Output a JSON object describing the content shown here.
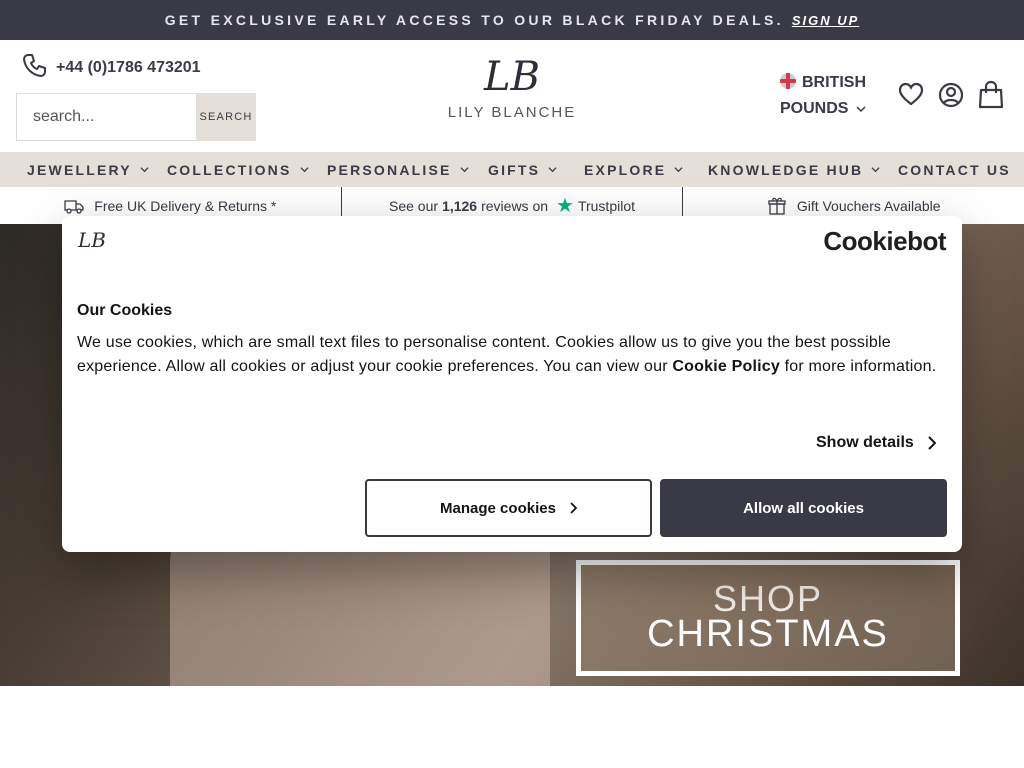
{
  "promo": {
    "text": "GET EXCLUSIVE EARLY ACCESS TO OUR BLACK FRIDAY DEALS.",
    "link": "SIGN UP"
  },
  "header": {
    "phone": "+44 (0)1786 473201",
    "search_placeholder": "search...",
    "search_button": "SEARCH",
    "logo_monogram": "LB",
    "logo_name": "LILY BLANCHE",
    "currency_line1": "BRITISH",
    "currency_line2": "POUNDS",
    "icons": [
      "phone-icon",
      "heart-icon",
      "account-icon",
      "bag-icon",
      "chevron-down-icon"
    ]
  },
  "nav": {
    "items": [
      {
        "label": "JEWELLERY"
      },
      {
        "label": "COLLECTIONS"
      },
      {
        "label": "PERSONALISE"
      },
      {
        "label": "GIFTS"
      },
      {
        "label": "EXPLORE"
      },
      {
        "label": "KNOWLEDGE HUB"
      },
      {
        "label": "CONTACT US"
      }
    ]
  },
  "usp": {
    "delivery": "Free UK Delivery & Returns *",
    "reviews_pre": "See our",
    "reviews_count": "1,126",
    "reviews_post": "reviews on",
    "trustpilot": "Trustpilot",
    "vouchers": "Gift Vouchers Available"
  },
  "hero": {
    "cta_line1": "SHOP",
    "cta_line2": "CHRISTMAS"
  },
  "cookie": {
    "monogram": "LB",
    "brand": "Cookiebot",
    "title": "Our Cookies",
    "body_before_link": "We use cookies, which are small text files to personalise content. Cookies allow us to give you the best possible experience. Allow all cookies or adjust your cookie preferences. You can view our ",
    "link": "Cookie Policy",
    "body_after_link": " for more information.",
    "show_details": "Show details",
    "manage": "Manage cookies",
    "allow": "Allow all cookies"
  },
  "colors": {
    "dark": "#3a3946",
    "nav_bg": "#e4dfd8",
    "trustpilot_green": "#00b67a"
  }
}
